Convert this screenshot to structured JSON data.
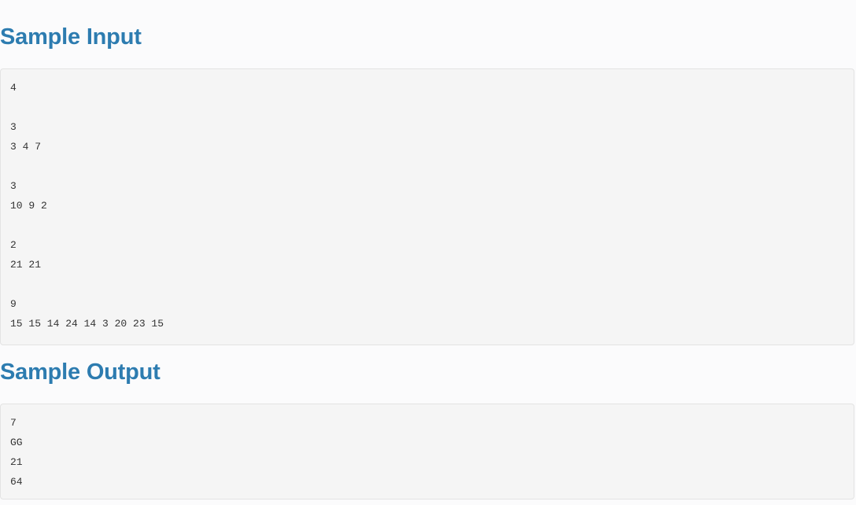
{
  "page": {
    "background_color": "#fbfbfc",
    "heading_color": "#2d7cb0",
    "code_background_color": "#f5f5f5",
    "code_border_color": "#e3e3e3",
    "code_text_color": "#333333"
  },
  "sections": {
    "sample_input": {
      "heading": "Sample Input",
      "code": "4\n\n3\n3 4 7\n\n3\n10 9 2\n\n2\n21 21\n\n9\n15 15 14 24 14 3 20 23 15"
    },
    "sample_output": {
      "heading": "Sample Output",
      "code": "7\nGG\n21\n64"
    }
  }
}
